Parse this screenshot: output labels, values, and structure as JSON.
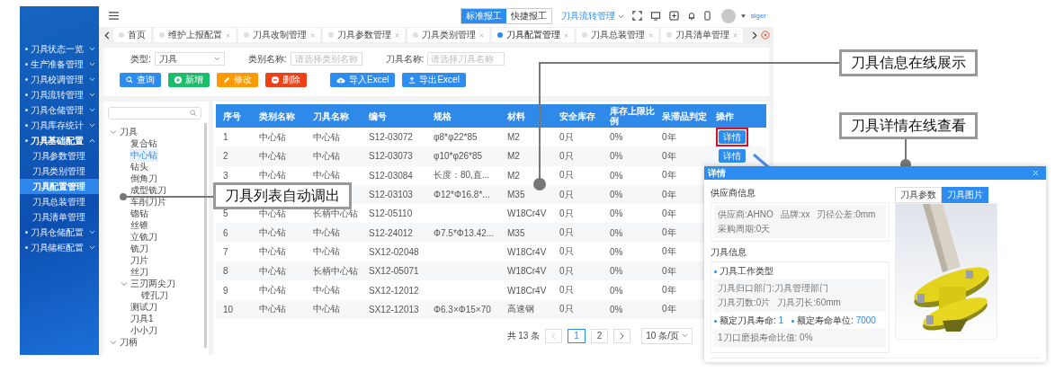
{
  "sidebar": {
    "items": [
      {
        "label": "刀具状态一览",
        "expanded": false
      },
      {
        "label": "生产准备管理",
        "expanded": false
      },
      {
        "label": "刀具校调管理",
        "expanded": false
      },
      {
        "label": "刀具流转管理",
        "expanded": false
      },
      {
        "label": "刀具仓储管理",
        "expanded": false
      },
      {
        "label": "刀具库存统计",
        "expanded": false
      },
      {
        "label": "刀具基础配置",
        "expanded": true,
        "children": [
          {
            "label": "刀具参数管理",
            "selected": false
          },
          {
            "label": "刀具类别管理",
            "selected": false
          },
          {
            "label": "刀具配置管理",
            "selected": true
          },
          {
            "label": "刀具总装管理",
            "selected": false
          },
          {
            "label": "刀具清单管理",
            "selected": false
          }
        ]
      },
      {
        "label": "刀具仓储配置",
        "expanded": false
      },
      {
        "label": "刀具储柜配置",
        "expanded": false
      }
    ]
  },
  "topbar": {
    "report_modes": [
      {
        "label": "标准报工",
        "selected": true
      },
      {
        "label": "快捷报工",
        "selected": false
      }
    ],
    "menu": "刀具流转管理",
    "user": "siger"
  },
  "tabs": [
    {
      "label": "首页",
      "selected": false,
      "closable": false
    },
    {
      "label": "维护上报配置",
      "selected": false,
      "closable": true
    },
    {
      "label": "刀具改制管理",
      "selected": false,
      "closable": true
    },
    {
      "label": "刀具参数管理",
      "selected": false,
      "closable": true
    },
    {
      "label": "刀具类别管理",
      "selected": false,
      "closable": true
    },
    {
      "label": "刀具配置管理",
      "selected": true,
      "closable": true
    },
    {
      "label": "刀具总装管理",
      "selected": false,
      "closable": true
    },
    {
      "label": "刀具清单管理",
      "selected": false,
      "closable": true
    }
  ],
  "filters": [
    {
      "kind": "select",
      "label": "类型:",
      "value": "刀具"
    },
    {
      "kind": "select",
      "label": "类别名称:",
      "placeholder": "请选择类别名称"
    },
    {
      "kind": "input",
      "label": "刀具名称:",
      "placeholder": "请选择刀具名称"
    }
  ],
  "toolbar": [
    {
      "kind": "search",
      "label": "查询"
    },
    {
      "kind": "add",
      "label": "新增"
    },
    {
      "kind": "edit",
      "label": "修改"
    },
    {
      "kind": "delete",
      "label": "删除"
    },
    {
      "kind": "import",
      "label": "导入Excel"
    },
    {
      "kind": "export",
      "label": "导出Excel"
    }
  ],
  "tree": {
    "items": [
      {
        "label": "刀具",
        "selected": false,
        "expanded": true,
        "children": [
          {
            "label": "复合钻",
            "selected": false
          },
          {
            "label": "中心钻",
            "selected": true
          },
          {
            "label": "钻头",
            "selected": false
          },
          {
            "label": "倒角刀",
            "selected": false
          },
          {
            "label": "成型铣刀",
            "selected": false
          },
          {
            "label": "车削刀片",
            "selected": false
          },
          {
            "label": "锪钻",
            "selected": false
          },
          {
            "label": "丝锥",
            "selected": false
          },
          {
            "label": "立铣刀",
            "selected": false
          },
          {
            "label": "铣刀",
            "selected": false
          },
          {
            "label": "刀片",
            "selected": false
          },
          {
            "label": "丝刀",
            "selected": false
          },
          {
            "label": "三刃两尖刀",
            "selected": false,
            "expanded": true,
            "children": [
              {
                "label": "镗孔刀",
                "selected": false
              }
            ]
          },
          {
            "label": "测试刀",
            "selected": false
          },
          {
            "label": "刀具1",
            "selected": false
          },
          {
            "label": "小小刀",
            "selected": false
          }
        ]
      },
      {
        "label": "刀柄",
        "selected": false,
        "expanded": true
      }
    ]
  },
  "table": {
    "columns": [
      "序号",
      "类别名称",
      "刀具名称",
      "编号",
      "规格",
      "材料",
      "安全库存",
      "库存上限比例",
      "呆滞品判定",
      "操作"
    ],
    "rows": [
      {
        "cells": [
          "1",
          "中心钻",
          "中心钻",
          "S12-03072",
          "φ8*φ22*85",
          "M2",
          "0只",
          "0%",
          "0年"
        ],
        "action": "详情",
        "highlighted": true
      },
      {
        "cells": [
          "2",
          "中心钻",
          "中心钻",
          "S12-03073",
          "φ10*φ26*85",
          "M2",
          "0只",
          "0%",
          "0年"
        ],
        "action": "详情",
        "highlighted": false
      },
      {
        "cells": [
          "3",
          "中心钻",
          "中心钻",
          "S12-03084",
          "长度：80,直...",
          "M2",
          "0只",
          "0%",
          "0年"
        ]
      },
      {
        "cells": [
          null,
          null,
          null,
          "S12-03103",
          "Φ12*Φ16.8*...",
          "M35",
          "0只",
          "0%",
          "0年"
        ]
      },
      {
        "cells": [
          "5",
          "中心钻",
          "长柄中心钻",
          "S12-05110",
          null,
          "W18Cr4V",
          "0只",
          "0%",
          "0年"
        ]
      },
      {
        "cells": [
          "6",
          "中心钻",
          "中心钻",
          "S12-24012",
          "Φ7.5*Φ13.42...",
          "M35",
          "0只",
          "0%",
          "0年"
        ]
      },
      {
        "cells": [
          "7",
          "中心钻",
          "中心钻",
          "SX12-02048",
          null,
          "W18Cr4V",
          "0只",
          "0%",
          "0年"
        ]
      },
      {
        "cells": [
          "8",
          "中心钻",
          "长柄中心钻",
          "SX12-05071",
          null,
          "W18Cr4V",
          "0只",
          "0%",
          "0年"
        ]
      },
      {
        "cells": [
          "9",
          "中心钻",
          "中心钻",
          "SX12-12012",
          null,
          "W18Cr4V",
          "0只",
          "0%",
          "0年"
        ]
      },
      {
        "cells": [
          "10",
          "中心钻",
          "中心钻",
          "SX12-12013",
          "Φ6.3×Φ15×70",
          "高速钢",
          "0只",
          "0%",
          "0年"
        ]
      }
    ]
  },
  "pagination": {
    "total": "共 13 条",
    "pages": [
      {
        "label": "1",
        "selected": true
      },
      {
        "label": "2",
        "selected": false
      }
    ],
    "page_size": "10 条/页"
  },
  "detail_dialog": {
    "title": "详情",
    "supplier": {
      "title": "供应商信息",
      "fields": [
        "供应商:AHNO",
        "品牌:xx",
        "刃径公差:0mm",
        "采购周期:0天"
      ]
    },
    "tool": {
      "title": "刀具信息",
      "work_type": {
        "title": "刀具工作类型",
        "fields": [
          "刀具归口部门:刀具管理部门",
          "刀具刃数:0片",
          "刀具刃长:60mm"
        ]
      },
      "life": {
        "items": [
          {
            "label": "额定刀具寿命:",
            "value": "1"
          },
          {
            "label": "额定寿命单位:",
            "value": "7000"
          }
        ],
        "fields": [
          "1刀口磨损寿命比值: 0%"
        ]
      }
    },
    "image_tabs": [
      {
        "label": "刀具参数",
        "selected": false
      },
      {
        "label": "刀具图片",
        "selected": true
      }
    ]
  },
  "callouts": [
    "刀具信息在线展示",
    "刀具详情在线查看",
    "刀具列表自动调出"
  ]
}
